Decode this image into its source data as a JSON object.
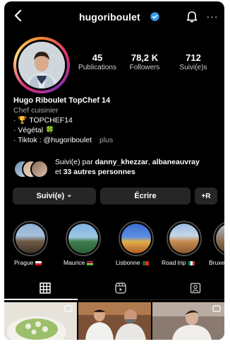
{
  "header": {
    "username": "hugoriboulet",
    "more_glyph": "···",
    "icons": [
      "back-arrow-icon",
      "verified-badge-icon",
      "bell-icon",
      "more-icon"
    ]
  },
  "stats": {
    "posts": {
      "value": "45",
      "label": "Publications"
    },
    "followers": {
      "value": "78,2 K",
      "label": "Followers"
    },
    "following": {
      "value": "712",
      "label": "Suivi(e)s"
    }
  },
  "bio": {
    "full_name": "Hugo Riboulet TopChef 14",
    "category": "Chef cuisinier",
    "line1_bullet": "· ",
    "line1_emoji": "🏆",
    "line1_text": " TOPCHEF14",
    "line2_bullet": "· ",
    "line2_text": "Végétal ",
    "line2_emoji": "🍀",
    "line3_bullet": "· ",
    "line3_text": "Tiktok : @hugoriboulet",
    "line3_more": "plus"
  },
  "followed_by": {
    "prefix": "Suivi(e) par ",
    "user1": "danny_khezzar",
    "sep": ", ",
    "user2": "albaneauvray",
    "middle": "et ",
    "others": "33 autres personnes"
  },
  "buttons": {
    "follow": "Suivi(e)",
    "follow_chevron": "⌄",
    "message": "Écrire",
    "add_user": "+R"
  },
  "highlights": [
    {
      "label": "Prague",
      "flag": "czech"
    },
    {
      "label": "Maurice",
      "flag": "mauritius"
    },
    {
      "label": "Lisbonne",
      "flag": "portugal"
    },
    {
      "label": "Road trip",
      "flag": "italy"
    },
    {
      "label": "Bruxell",
      "flag": "none"
    }
  ],
  "tabs": [
    "grid-icon",
    "reels-icon",
    "tagged-icon"
  ],
  "colors": {
    "background": "#000000",
    "verified": "#3897f0",
    "button_bg": "#262626",
    "secondary_text": "#a8a8a8"
  }
}
